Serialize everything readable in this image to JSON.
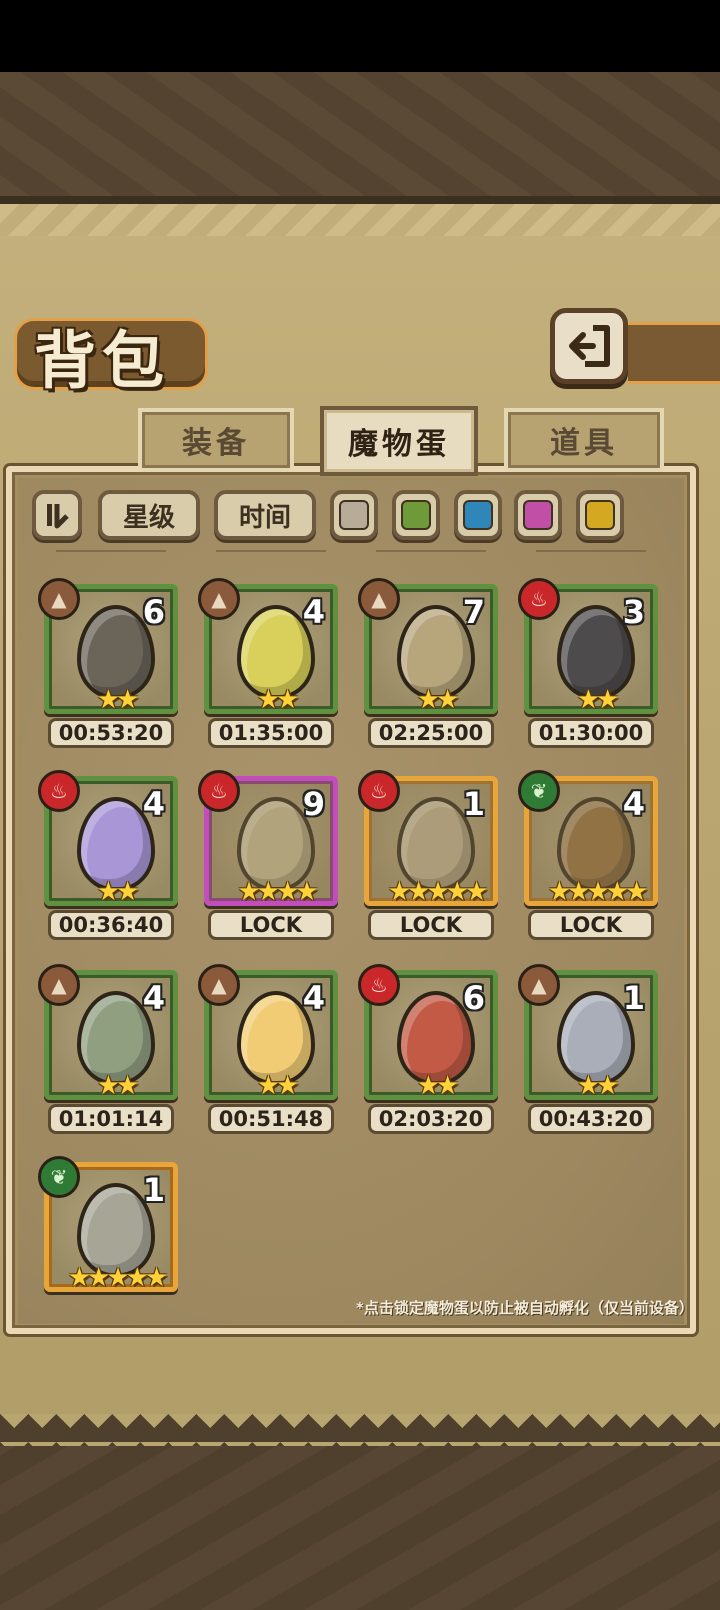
{
  "header": {
    "title": "背包",
    "back_icon": "back-arrow-icon"
  },
  "tabs": [
    {
      "label": "装备",
      "active": false
    },
    {
      "label": "魔物蛋",
      "active": true
    },
    {
      "label": "道具",
      "active": false
    }
  ],
  "filters": {
    "sort_icon": "sort-icon",
    "star_label": "星级",
    "time_label": "时间",
    "colors": [
      "#b7ac98",
      "#6f9a3a",
      "#2f86b8",
      "#c04fa5",
      "#d5a821"
    ]
  },
  "eggs": [
    {
      "element": "earth",
      "count": "6",
      "stars": "★★",
      "timer": "00:53:20",
      "frame": "green",
      "color": "#6a6459"
    },
    {
      "element": "earth",
      "count": "4",
      "stars": "★★",
      "timer": "01:35:00",
      "frame": "green",
      "color": "#d8d05a"
    },
    {
      "element": "earth",
      "count": "7",
      "stars": "★★",
      "timer": "02:25:00",
      "frame": "green",
      "color": "#b7a57c"
    },
    {
      "element": "fire",
      "count": "3",
      "stars": "★★",
      "timer": "01:30:00",
      "frame": "green",
      "color": "#4e4b4c"
    },
    {
      "element": "fire",
      "count": "4",
      "stars": "★★",
      "timer": "00:36:40",
      "frame": "green",
      "color": "#a896d6"
    },
    {
      "element": "fire",
      "count": "9",
      "stars": "★★★★",
      "timer": "LOCK",
      "frame": "purple",
      "color": "#c0b58e"
    },
    {
      "element": "fire",
      "count": "1",
      "stars": "★★★★★",
      "timer": "LOCK",
      "frame": "gold",
      "color": "#b9ab8a"
    },
    {
      "element": "nature",
      "count": "4",
      "stars": "★★★★★",
      "timer": "LOCK",
      "frame": "gold",
      "color": "#8e6b3b"
    },
    {
      "element": "earth",
      "count": "4",
      "stars": "★★",
      "timer": "01:01:14",
      "frame": "green",
      "color": "#8f9f80"
    },
    {
      "element": "earth",
      "count": "4",
      "stars": "★★",
      "timer": "00:51:48",
      "frame": "green",
      "color": "#f2cc74"
    },
    {
      "element": "fire",
      "count": "6",
      "stars": "★★",
      "timer": "02:03:20",
      "frame": "green",
      "color": "#c25a45"
    },
    {
      "element": "earth",
      "count": "1",
      "stars": "★★",
      "timer": "00:43:20",
      "frame": "green",
      "color": "#a9aeb9"
    },
    {
      "element": "nature",
      "count": "1",
      "stars": "★★★★★",
      "timer": "",
      "frame": "gold",
      "color": "#a7a596"
    }
  ],
  "footnote": "*点击锁定魔物蛋以防止被自动孵化（仅当前设备）"
}
